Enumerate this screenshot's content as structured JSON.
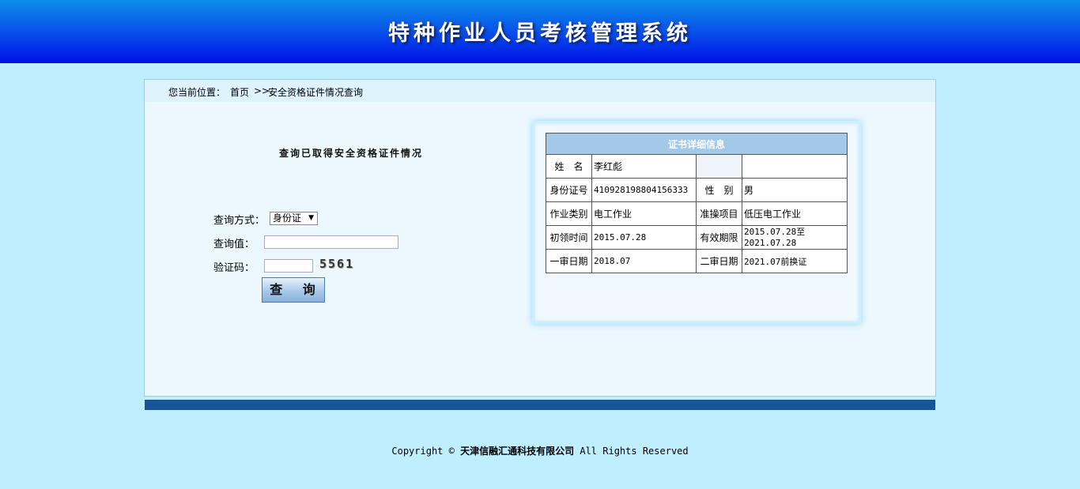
{
  "header": {
    "title": "特种作业人员考核管理系统"
  },
  "breadcrumb": {
    "prefix": "您当前位置：",
    "home": "首页",
    "separator": ">>",
    "current": "安全资格证件情况查询"
  },
  "query": {
    "title": "查询已取得安全资格证件情况",
    "method_label": "查询方式：",
    "method_value": "身份证",
    "value_label": "查询值：",
    "value_input": "",
    "captcha_label": "验证码：",
    "captcha_input": "",
    "captcha_image_text": "5561",
    "button_label": "查 询"
  },
  "certificate": {
    "title": "证书详细信息",
    "rows": [
      {
        "l1": "姓　名",
        "v1": "李红彪",
        "l2": "",
        "v2": ""
      },
      {
        "l1": "身份证号",
        "v1": "410928198804156333",
        "l2": "性　别",
        "v2": "男"
      },
      {
        "l1": "作业类别",
        "v1": "电工作业",
        "l2": "准操项目",
        "v2": "低压电工作业"
      },
      {
        "l1": "初领时间",
        "v1": "2015.07.28",
        "l2": "有效期限",
        "v2": "2015.07.28至 2021.07.28"
      },
      {
        "l1": "一审日期",
        "v1": "2018.07",
        "l2": "二审日期",
        "v2": "2021.07前换证"
      }
    ]
  },
  "footer": {
    "copyright": "Copyright ©",
    "company": "天津信融汇通科技有限公司",
    "rights": "All Rights Reserved"
  }
}
